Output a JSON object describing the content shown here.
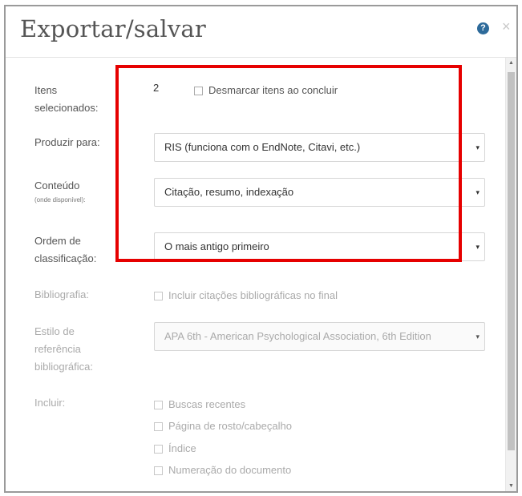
{
  "dialog": {
    "title": "Exportar/salvar",
    "help_icon": "?",
    "close_icon": "×"
  },
  "form": {
    "selected_items_label": "Itens selecionados:",
    "selected_count": "2",
    "deselect_label": "Desmarcar itens ao concluir",
    "produce_for_label": "Produzir para:",
    "produce_for_value": "RIS (funciona com o EndNote, Citavi, etc.)",
    "content_label": "Conteúdo",
    "content_sublabel": "(onde disponível):",
    "content_value": "Citação, resumo, indexação",
    "sort_label": "Ordem de classificação:",
    "sort_value": "O mais antigo primeiro",
    "bibliography_label": "Bibliografia:",
    "bibliography_option": "Incluir citações bibliográficas no final",
    "style_label": "Estilo de referência bibliográfica:",
    "style_value": "APA 6th - American Psychological Association, 6th Edition",
    "include_label": "Incluir:",
    "include_options": [
      "Buscas recentes",
      "Página de rosto/cabeçalho",
      "Índice",
      "Numeração do documento"
    ]
  },
  "icons": {
    "caret": "▾",
    "scroll_up": "▲",
    "scroll_down": "▼"
  },
  "colors": {
    "highlight": "#e60000",
    "help_icon": "#2d6a9a"
  }
}
